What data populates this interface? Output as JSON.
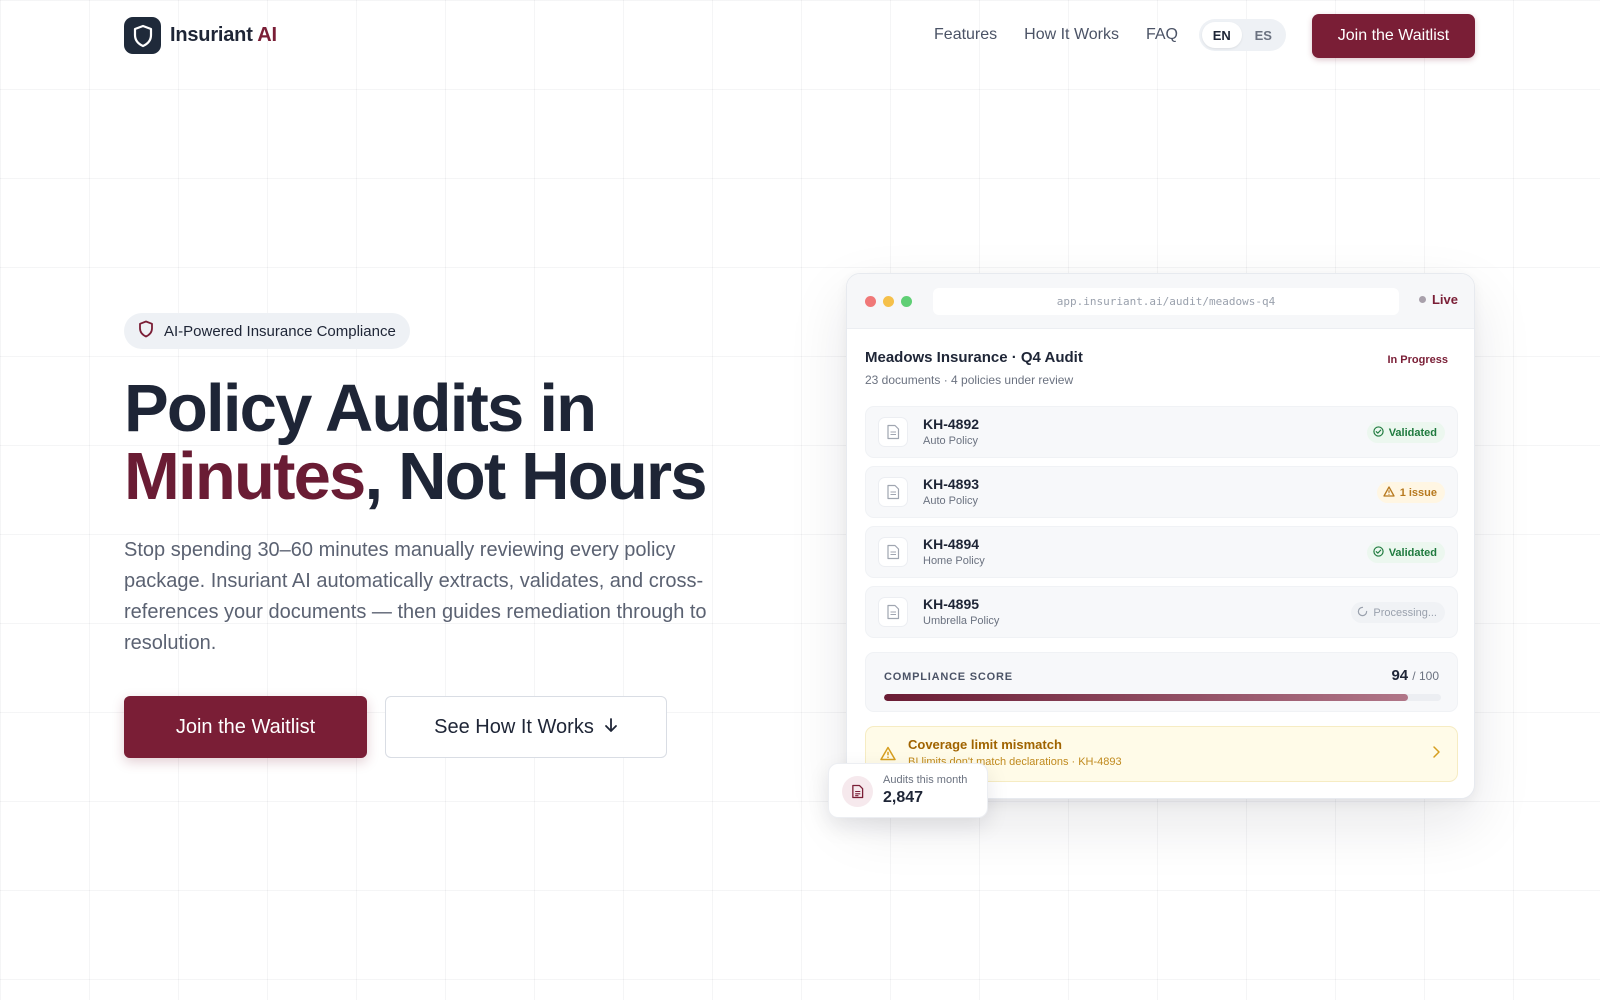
{
  "brand": {
    "name": "Insuriant",
    "accent": "AI",
    "primary_color": "#7a1e36",
    "dark_color": "#1e2536"
  },
  "nav": {
    "links": [
      "Features",
      "How It Works",
      "FAQ"
    ],
    "languages": [
      "EN",
      "ES"
    ],
    "active_language": "EN",
    "cta": "Join the Waitlist"
  },
  "hero": {
    "badge": "AI-Powered Insurance Compliance",
    "headline_line1": "Policy Audits in",
    "headline_accent": "Minutes",
    "headline_rest": ", Not Hours",
    "subtext": "Stop spending 30–60 minutes manually reviewing every policy package. Insuriant AI automatically extracts, validates, and cross-references your documents — then guides remediation through to resolution.",
    "primary_cta": "Join the Waitlist",
    "secondary_cta": "See How It Works"
  },
  "app": {
    "url": "app.insuriant.ai/audit/meadows-q4",
    "live_label": "Live",
    "title": "Meadows Insurance · Q4 Audit",
    "subtitle": "23 documents · 4 policies under review",
    "status": "In Progress",
    "rows": [
      {
        "id": "KH-4892",
        "type": "Auto Policy",
        "status": "Validated",
        "kind": "ok"
      },
      {
        "id": "KH-4893",
        "type": "Auto Policy",
        "status": "1 issue",
        "kind": "warn"
      },
      {
        "id": "KH-4894",
        "type": "Home Policy",
        "status": "Validated",
        "kind": "ok"
      },
      {
        "id": "KH-4895",
        "type": "Umbrella Policy",
        "status": "Processing...",
        "kind": "proc"
      }
    ],
    "score": {
      "label": "COMPLIANCE SCORE",
      "value": "94",
      "max": "/ 100",
      "fraction": 0.94
    },
    "alert": {
      "title": "Coverage limit mismatch",
      "detail": "BI limits don't match declarations · KH-4893"
    }
  },
  "floating_stat": {
    "label": "Audits this month",
    "value": "2,847"
  },
  "icons": {
    "logo": "shield-icon",
    "badge": "shield-icon",
    "row": "document-icon",
    "validated": "check-circle-icon",
    "issue": "warning-triangle-icon",
    "processing": "spinner-icon",
    "alert": "warning-triangle-icon",
    "alert_action": "chevron-right-icon",
    "secondary_cta": "arrow-down-icon",
    "stat": "document-icon"
  },
  "colors": {
    "validated": "#1f7a3e",
    "issue": "#b7791f",
    "processing": "#9aa1ad",
    "traffic_lights": [
      "#f07878",
      "#f5c04a",
      "#5fcf75"
    ]
  }
}
